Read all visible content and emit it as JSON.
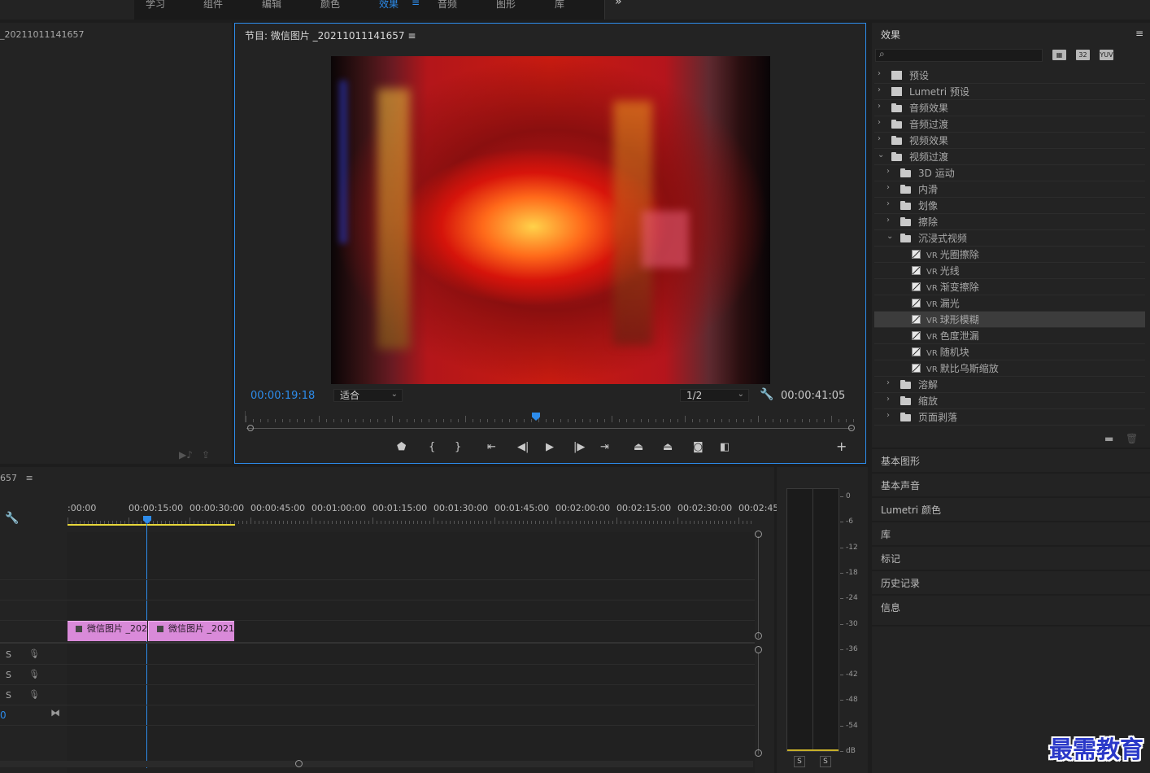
{
  "workspace_tabs": [
    "学习",
    "组件",
    "编辑",
    "颜色",
    "效果",
    "音频",
    "图形",
    "库"
  ],
  "active_workspace": "效果",
  "active_workspace_menu": "≡",
  "overflow_icon": "»",
  "source_panel": {
    "title": "_20211011141657"
  },
  "program": {
    "title": "节目: 微信图片 _20211011141657",
    "menu_icon": "≡",
    "current_time": "00:00:19:18",
    "fit_label": "适合",
    "resolution": "1/2",
    "duration": "00:00:41:05",
    "playhead_fraction": 0.48,
    "transport": [
      "add-marker",
      "mark-in",
      "mark-out",
      "go-to-in",
      "step-back",
      "play",
      "step-forward",
      "go-to-out",
      "lift",
      "extract",
      "export-frame",
      "comparison-view"
    ],
    "add_button": "+"
  },
  "effects": {
    "title": "效果",
    "menu_icon": "≡",
    "badges": [
      "32",
      "YUV"
    ],
    "tree": [
      {
        "label": "预设",
        "level": 0,
        "type": "preset",
        "open": false
      },
      {
        "label": "Lumetri 预设",
        "level": 0,
        "type": "preset",
        "open": false
      },
      {
        "label": "音频效果",
        "level": 0,
        "type": "folder",
        "open": false
      },
      {
        "label": "音频过渡",
        "level": 0,
        "type": "folder",
        "open": false
      },
      {
        "label": "视频效果",
        "level": 0,
        "type": "folder",
        "open": false
      },
      {
        "label": "视频过渡",
        "level": 0,
        "type": "folder",
        "open": true
      },
      {
        "label": "3D 运动",
        "level": 1,
        "type": "folder",
        "open": false
      },
      {
        "label": "内滑",
        "level": 1,
        "type": "folder",
        "open": false
      },
      {
        "label": "划像",
        "level": 1,
        "type": "folder",
        "open": false
      },
      {
        "label": "擦除",
        "level": 1,
        "type": "folder",
        "open": false
      },
      {
        "label": "沉浸式视频",
        "level": 1,
        "type": "folder",
        "open": true
      },
      {
        "label": "光圈擦除",
        "level": 2,
        "type": "vr"
      },
      {
        "label": "光线",
        "level": 2,
        "type": "vr"
      },
      {
        "label": "渐变擦除",
        "level": 2,
        "type": "vr"
      },
      {
        "label": "漏光",
        "level": 2,
        "type": "vr"
      },
      {
        "label": "球形模糊",
        "level": 2,
        "type": "vr",
        "selected": true
      },
      {
        "label": "色度泄漏",
        "level": 2,
        "type": "vr"
      },
      {
        "label": "随机块",
        "level": 2,
        "type": "vr"
      },
      {
        "label": "默比乌斯缩放",
        "level": 2,
        "type": "vr"
      },
      {
        "label": "溶解",
        "level": 1,
        "type": "folder",
        "open": false
      },
      {
        "label": "缩放",
        "level": 1,
        "type": "folder",
        "open": false
      },
      {
        "label": "页面剥落",
        "level": 1,
        "type": "folder",
        "open": false
      }
    ],
    "vr_prefix": "VR"
  },
  "collapsed_panels": [
    "基本图形",
    "基本声音",
    "Lumetri 颜色",
    "库",
    "标记",
    "历史记录",
    "信息"
  ],
  "timeline": {
    "title": "657",
    "menu_icon": "≡",
    "timecodes": [
      ":00:00",
      "00:00:15:00",
      "00:00:30:00",
      "00:00:45:00",
      "00:01:00:00",
      "00:01:15:00",
      "00:01:30:00",
      "00:01:45:00",
      "00:02:00:00",
      "00:02:15:00",
      "00:02:30:00",
      "00:02:45:"
    ],
    "clips": [
      "微信图片 _202",
      "微信图片 _2021"
    ],
    "audio_solo": [
      "S",
      "S",
      "S"
    ],
    "master_value": "0"
  },
  "meter": {
    "db_labels": [
      "0",
      "-6",
      "-12",
      "-18",
      "-24",
      "-30",
      "-36",
      "-42",
      "-48",
      "-54",
      "dB"
    ],
    "solo": [
      "S",
      "S"
    ]
  },
  "watermark": "最需教育",
  "colors": {
    "accent": "#2d8ceb",
    "clip": "#d98ad9",
    "in_out": "#e6d63a"
  }
}
